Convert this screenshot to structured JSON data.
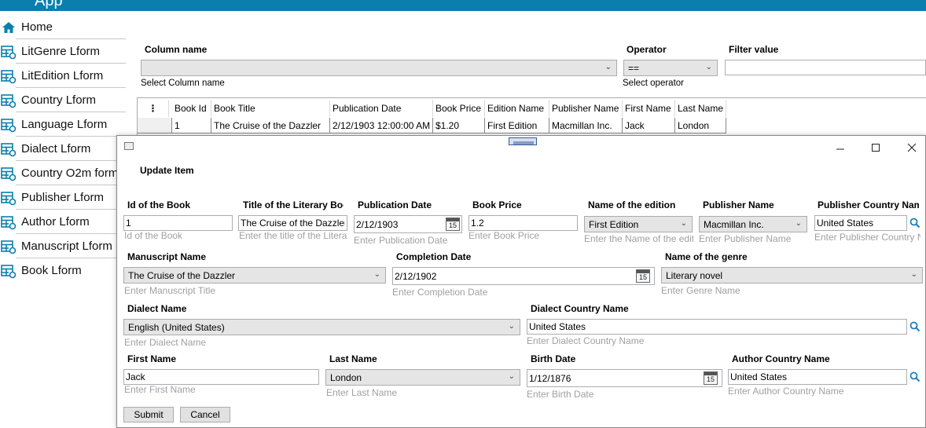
{
  "app": {
    "title": "App",
    "accent": "#0a7fae"
  },
  "sidebar": {
    "items": [
      {
        "label": "Home",
        "icon": "home-icon"
      },
      {
        "label": "LitGenre Lform",
        "icon": "form-icon"
      },
      {
        "label": "LitEdition Lform",
        "icon": "form-icon"
      },
      {
        "label": "Country Lform",
        "icon": "form-icon"
      },
      {
        "label": "Language Lform",
        "icon": "form-icon"
      },
      {
        "label": "Dialect Lform",
        "icon": "form-icon"
      },
      {
        "label": "Country O2m form",
        "icon": "form-icon"
      },
      {
        "label": "Publisher Lform",
        "icon": "form-icon"
      },
      {
        "label": "Author Lform",
        "icon": "form-icon"
      },
      {
        "label": "Manuscript Lform",
        "icon": "form-icon"
      },
      {
        "label": "Book Lform",
        "icon": "form-icon"
      }
    ]
  },
  "filter": {
    "column_label": "Column name",
    "column_hint": "Select Column name",
    "operator_label": "Operator",
    "operator_value": "==",
    "operator_hint": "Select operator",
    "value_label": "Filter value",
    "value_text": ""
  },
  "grid": {
    "columns": [
      "⋮",
      "Book Id",
      "Book Title",
      "Publication Date",
      "Book Price",
      "Edition Name",
      "Publisher Name",
      "First Name",
      "Last Name"
    ],
    "rows": [
      [
        "",
        "1",
        "The Cruise of the Dazzler",
        "2/12/1903 12:00:00 AM",
        "$1.20",
        "First Edition",
        "Macmillan Inc.",
        "Jack",
        "London"
      ]
    ]
  },
  "dialog": {
    "heading": "Update Item",
    "buttons": {
      "submit": "Submit",
      "cancel": "Cancel"
    },
    "fields": {
      "book_id": {
        "label": "Id of the Book",
        "value": "1",
        "hint": "Id of the Book"
      },
      "title": {
        "label": "Title of the Literary Book",
        "value": "The Cruise of the Dazzler",
        "hint": "Enter the title of the Literary Book"
      },
      "pub_date": {
        "label": "Publication Date",
        "value": "2/12/1903",
        "hint": "Enter Publication Date"
      },
      "price": {
        "label": "Book Price",
        "value": "1.2",
        "hint": "Enter Book Price"
      },
      "edition": {
        "label": "Name of the edition",
        "value": "First Edition",
        "hint": "Enter the Name of the edition"
      },
      "publisher": {
        "label": "Publisher Name",
        "value": "Macmillan Inc.",
        "hint": "Enter Publisher Name"
      },
      "pub_country": {
        "label": "Publisher Country Name",
        "value": "United States",
        "hint": "Enter Publisher Country Name"
      },
      "manuscript": {
        "label": "Manuscript Name",
        "value": "The Cruise of the Dazzler",
        "hint": "Enter Manuscript Title"
      },
      "completion": {
        "label": "Completion Date",
        "value": "2/12/1902",
        "hint": "Enter Completion Date"
      },
      "genre": {
        "label": "Name of the genre",
        "value": "Literary novel",
        "hint": "Enter Genre Name"
      },
      "dialect": {
        "label": "Dialect Name",
        "value": "English (United States)",
        "hint": "Enter Dialect Name"
      },
      "dialect_country": {
        "label": "Dialect Country Name",
        "value": "United States",
        "hint": "Enter Dialect Country Name"
      },
      "first_name": {
        "label": "First Name",
        "value": "Jack",
        "hint": "Enter First Name"
      },
      "last_name": {
        "label": "Last Name",
        "value": "London",
        "hint": "Enter Last Name"
      },
      "birth_date": {
        "label": "Birth Date",
        "value": "1/12/1876",
        "hint": "Enter Birth Date"
      },
      "author_country": {
        "label": "Author Country Name",
        "value": "United States",
        "hint": "Enter Author Country Name"
      }
    },
    "calendar_day": "15"
  }
}
